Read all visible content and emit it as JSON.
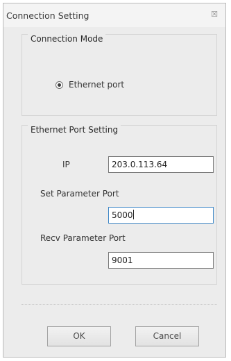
{
  "window": {
    "title": "Connection Setting",
    "close_glyph": "☒"
  },
  "connection_mode": {
    "legend": "Connection Mode",
    "radio_label": "Ethernet port",
    "radio_selected": true
  },
  "ethernet_setting": {
    "legend": "Ethernet Port Setting",
    "ip_label": "IP",
    "ip_value": "203.0.113.64",
    "set_port_label": "Set Parameter Port",
    "set_port_value": "5000",
    "recv_port_label": "Recv Parameter Port",
    "recv_port_value": "9001"
  },
  "buttons": {
    "ok": "OK",
    "cancel": "Cancel"
  }
}
